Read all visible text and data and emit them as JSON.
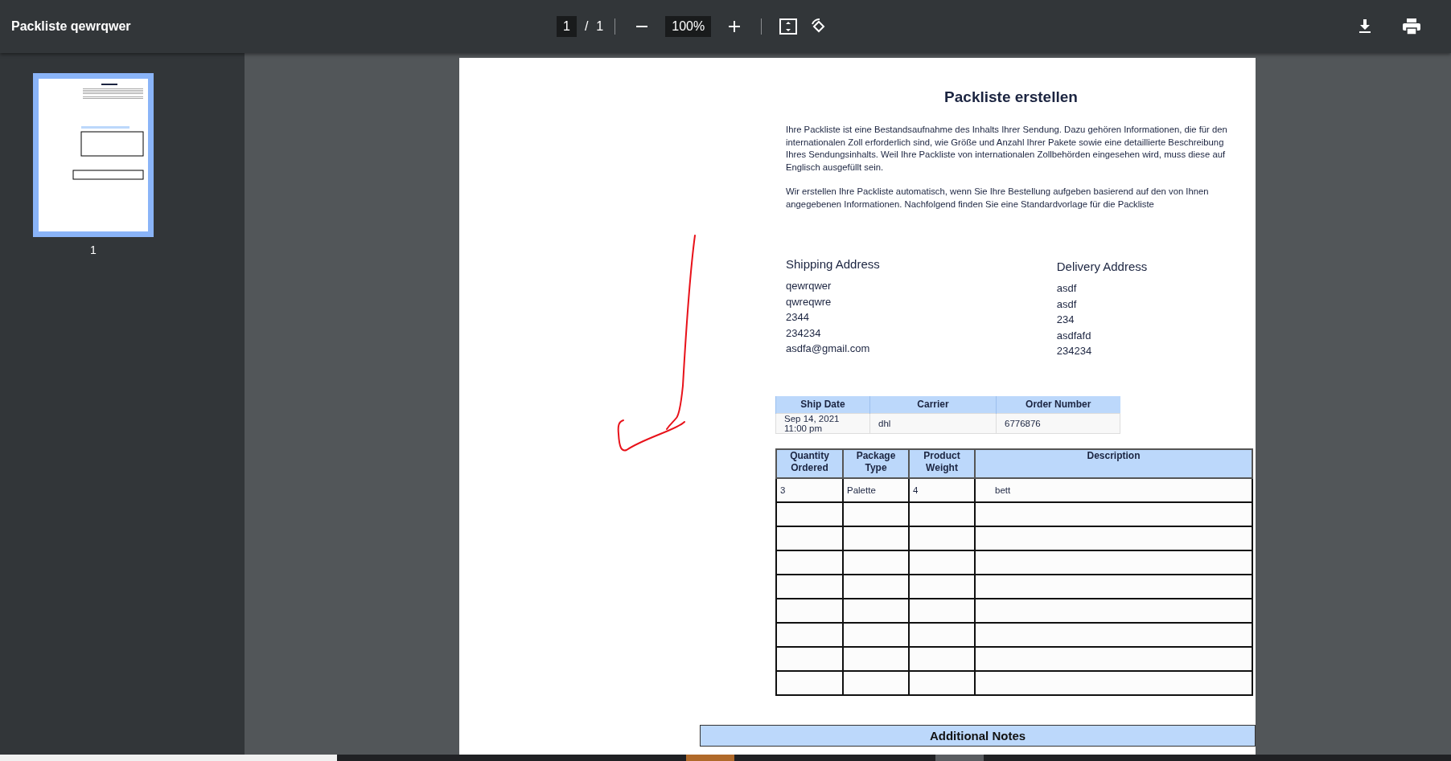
{
  "toolbar": {
    "title": "Packliste qewrqwer",
    "page_current": "1",
    "page_separator": "/",
    "page_total": "1",
    "zoom": "100%"
  },
  "thumbnails": [
    {
      "label": "1",
      "selected": true
    }
  ],
  "document": {
    "title": "Packliste erstellen",
    "paragraphs": [
      "Ihre Packliste ist eine Bestandsaufnahme des Inhalts Ihrer Sendung. Dazu gehören Informationen, die für den internationalen Zoll erforderlich sind, wie Größe und Anzahl Ihrer Pakete sowie eine detaillierte Beschreibung Ihres Sendungsinhalts. Weil Ihre Packliste von internationalen Zollbehörden eingesehen wird, muss diese auf Englisch ausgefüllt sein.",
      "Wir erstellen Ihre Packliste automatisch, wenn Sie Ihre Bestellung aufgeben basierend auf den von Ihnen angegebenen Informationen. Nachfolgend finden Sie eine Standardvorlage für die Packliste"
    ],
    "shipping_address": {
      "heading": "Shipping Address",
      "lines": [
        "qewrqwer",
        "qwreqwre",
        "2344",
        "234234",
        "asdfa@gmail.com"
      ]
    },
    "delivery_address": {
      "heading": "Delivery Address",
      "lines": [
        "asdf",
        "asdf",
        "234",
        "asdfafd",
        "234234"
      ]
    },
    "shipment_table": {
      "columns": [
        "Ship Date",
        "Carrier",
        "Order Number"
      ],
      "row": [
        "Sep 14, 2021 11:00 pm",
        "dhl",
        "6776876"
      ]
    },
    "items_table": {
      "columns": [
        "Quantity Ordered",
        "Package Type",
        "Product Weight",
        "Description"
      ],
      "rows": [
        [
          "3",
          "Palette",
          "4",
          "bett"
        ]
      ]
    },
    "notes_heading": "Additional Notes"
  }
}
